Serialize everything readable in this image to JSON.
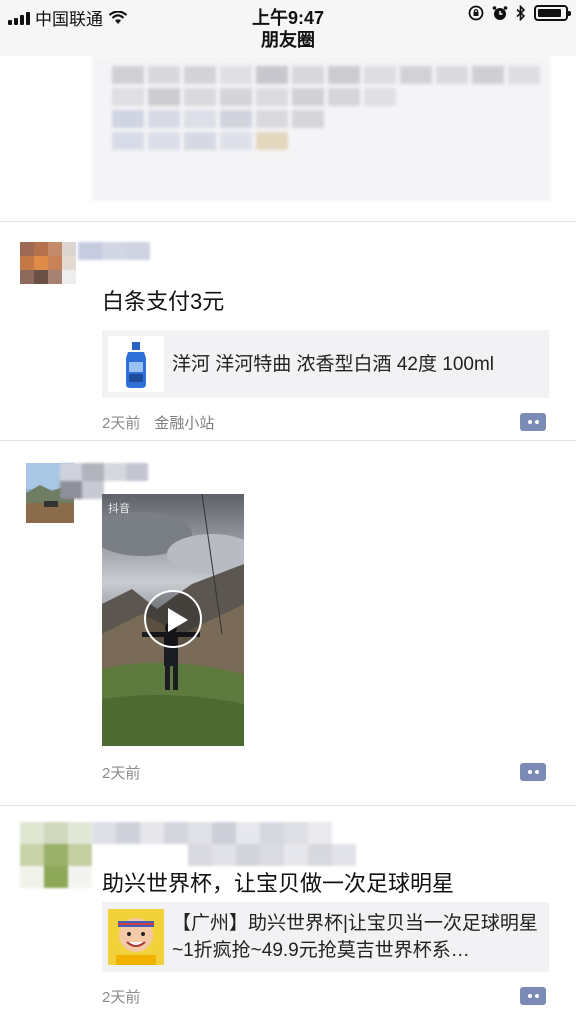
{
  "status_bar": {
    "carrier": "中国联通",
    "time": "上午9:47",
    "battery_level": 0.9
  },
  "nav": {
    "title": "朋友圈"
  },
  "posts": [
    {
      "content": "白条支付3元",
      "link_title": "洋河 洋河特曲 浓香型白酒 42度 100ml",
      "time": "2天前",
      "source": "金融小站"
    },
    {
      "video_overlay": "抖音",
      "time": "2天前"
    },
    {
      "content": "助兴世界杯，让宝贝做一次足球明星",
      "link_title": "【广州】助兴世界杯|让宝贝当一次足球明星~1折疯抢~49.9元抢莫吉世界杯系…",
      "time": "2天前"
    }
  ],
  "icons": {
    "wifi": "wifi-icon",
    "lock_rotation": "orientation-lock-icon",
    "alarm": "alarm-icon",
    "bluetooth": "bluetooth-icon",
    "comment": "comment-icon",
    "play": "play-icon"
  },
  "colors": {
    "comment_button": "#7b8bb6",
    "link_card_bg": "#f2f2f4",
    "meta_text": "#8b8b8b"
  }
}
